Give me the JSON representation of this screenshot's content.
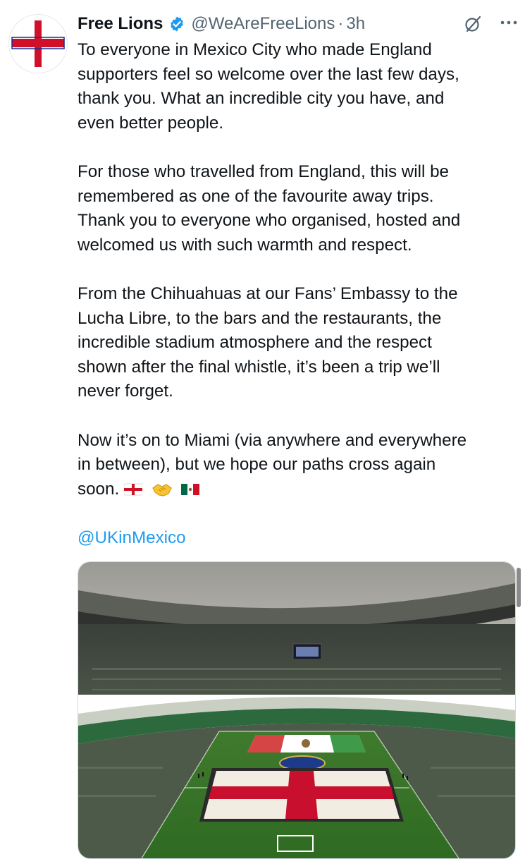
{
  "tweet": {
    "display_name": "Free Lions",
    "handle": "@WeAreFreeLions",
    "separator": "·",
    "time": "3h",
    "avatar_text": "Free Lions",
    "paragraphs": [
      [
        "To everyone in Mexico City who made England",
        "supporters feel so welcome over the last few days,",
        "thank you. What an incredible city you have, and",
        "even better people."
      ],
      [
        "For those who travelled from England, this will be",
        "remembered as one of the favourite away trips.",
        "Thank you to everyone who organised, hosted and",
        "welcomed us with such warmth and respect."
      ],
      [
        "From the Chihuahuas at our Fans’ Embassy to the",
        "Lucha Libre, to the bars and the restaurants, the",
        "incredible stadium atmosphere and the respect",
        "shown after the final whistle, it’s been a trip we’ll",
        "never forget."
      ],
      [
        "Now it’s on to Miami (via anywhere and everywhere",
        "in between), but we hope our paths cross again"
      ]
    ],
    "last_line": "soon.",
    "emojis": [
      "england-flag-emoji",
      "handshake-emoji",
      "mexico-flag-emoji"
    ],
    "mention": "@UKinMexico"
  },
  "media": {
    "kind": "photo",
    "subject": "stadium with England and Mexico flags on the pitch"
  },
  "icons": {
    "verified": "verified-badge-icon",
    "grok": "grok-icon",
    "more": "more-options-icon"
  },
  "colors": {
    "link": "#1d9bf0",
    "secondary": "#536471",
    "text": "#0f1419",
    "verified": "#1d9bf0"
  }
}
